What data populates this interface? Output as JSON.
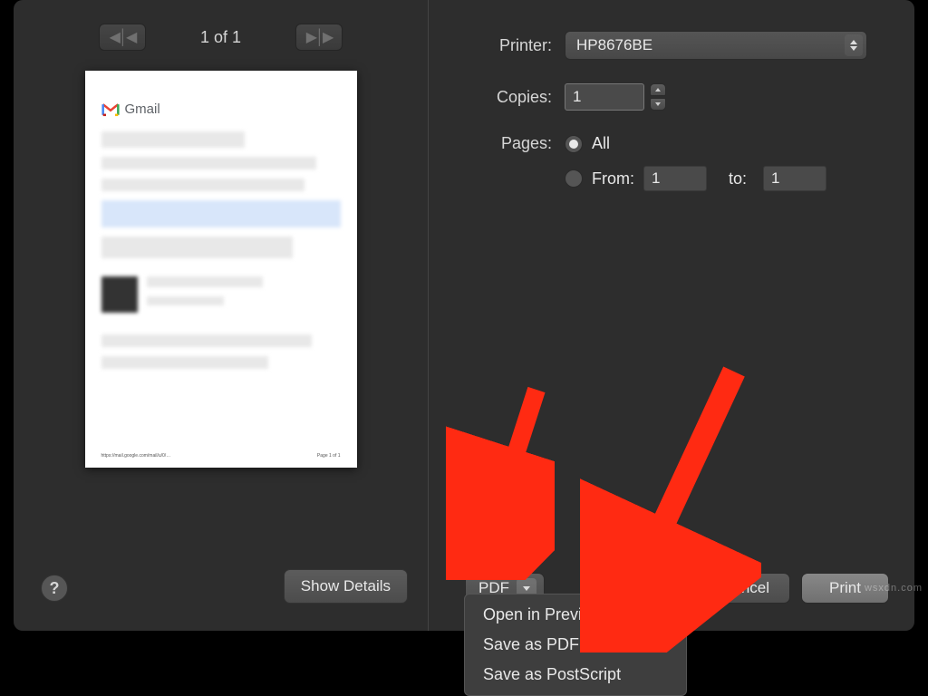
{
  "pager": {
    "indicator": "1 of 1"
  },
  "preview": {
    "gmail_label": "Gmail",
    "page_text": "Page 1 of 1"
  },
  "left_buttons": {
    "help": "?",
    "show_details": "Show Details"
  },
  "printer": {
    "label": "Printer:",
    "value": "HP8676BE"
  },
  "copies": {
    "label": "Copies:",
    "value": "1"
  },
  "pages": {
    "label": "Pages:",
    "all_label": "All",
    "from_label": "From:",
    "from_value": "1",
    "to_label": "to:",
    "to_value": "1"
  },
  "bottom": {
    "pdf_label": "PDF",
    "cancel": "Cancel",
    "print": "Print"
  },
  "dropdown": {
    "items": [
      "Open in Preview",
      "Save as PDF",
      "Save as PostScript"
    ]
  },
  "watermark": "wsxdn.com"
}
